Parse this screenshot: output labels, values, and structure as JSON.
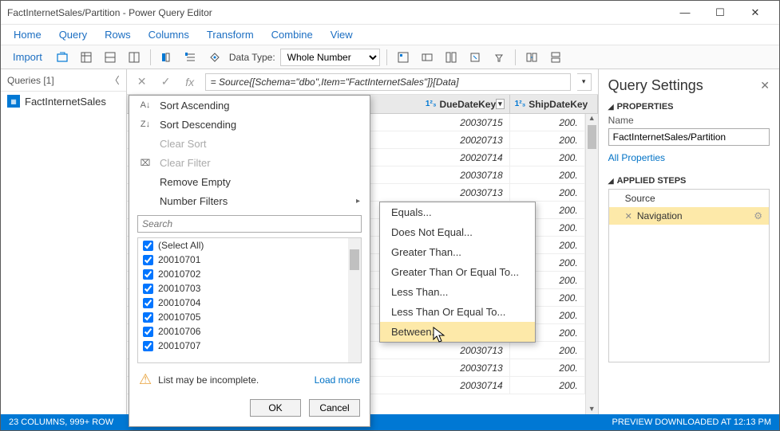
{
  "window": {
    "title": "FactInternetSales/Partition - Power Query Editor"
  },
  "menu": [
    "Home",
    "Query",
    "Rows",
    "Columns",
    "Transform",
    "Combine",
    "View"
  ],
  "toolbar": {
    "import": "Import",
    "datatype_label": "Data Type:",
    "datatype_value": "Whole Number"
  },
  "queries": {
    "header": "Queries [1]",
    "items": [
      "FactInternetSales"
    ]
  },
  "formula": {
    "text": "= Source{[Schema=\"dbo\",Item=\"FactInternetSales\"]}[Data]"
  },
  "grid": {
    "columns": [
      "DueDateKey",
      "ShipDateKey"
    ],
    "rows": [
      {
        "due": "20030715",
        "ship": "200."
      },
      {
        "due": "20020713",
        "ship": "200."
      },
      {
        "due": "20020714",
        "ship": "200."
      },
      {
        "due": "20030718",
        "ship": "200."
      },
      {
        "due": "20030713",
        "ship": "200."
      },
      {
        "due": "",
        "ship": "200."
      },
      {
        "due": "",
        "ship": "200."
      },
      {
        "due": "",
        "ship": "200."
      },
      {
        "due": "",
        "ship": "200."
      },
      {
        "due": "",
        "ship": "200."
      },
      {
        "due": "",
        "ship": "200."
      },
      {
        "due": "",
        "ship": "200."
      },
      {
        "due": "20030713",
        "ship": "200."
      },
      {
        "due": "20030713",
        "ship": "200."
      },
      {
        "due": "20030713",
        "ship": "200."
      },
      {
        "due": "20030714",
        "ship": "200."
      }
    ]
  },
  "filter": {
    "sort_asc": "Sort Ascending",
    "sort_desc": "Sort Descending",
    "clear_sort": "Clear Sort",
    "clear_filter": "Clear Filter",
    "remove_empty": "Remove Empty",
    "number_filters": "Number Filters",
    "search_ph": "Search",
    "select_all": "(Select All)",
    "values": [
      "20010701",
      "20010702",
      "20010703",
      "20010704",
      "20010705",
      "20010706",
      "20010707"
    ],
    "warn": "List may be incomplete.",
    "load_more": "Load more",
    "ok": "OK",
    "cancel": "Cancel"
  },
  "submenu": [
    "Equals...",
    "Does Not Equal...",
    "Greater Than...",
    "Greater Than Or Equal To...",
    "Less Than...",
    "Less Than Or Equal To...",
    "Between..."
  ],
  "submenu_hl": 6,
  "settings": {
    "title": "Query Settings",
    "props": "PROPERTIES",
    "name_lbl": "Name",
    "name_val": "FactInternetSales/Partition",
    "all_props": "All Properties",
    "steps_lbl": "APPLIED STEPS",
    "steps": [
      "Source",
      "Navigation"
    ],
    "sel_step": 1
  },
  "status": {
    "left": "23 COLUMNS, 999+ ROW",
    "right": "PREVIEW DOWNLOADED AT 12:13 PM"
  }
}
